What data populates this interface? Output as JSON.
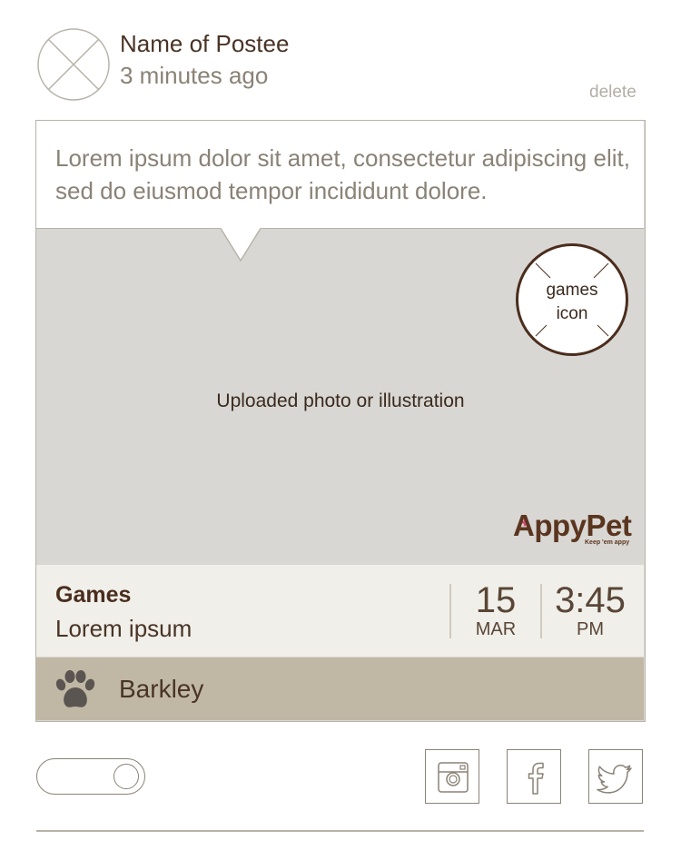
{
  "post": {
    "poster_name": "Name of Postee",
    "time_ago": "3 minutes ago",
    "delete_label": "delete",
    "caption": "Lorem ipsum dolor sit amet, consectetur adipiscing elit, sed do eiusmod tempor incididunt dolore."
  },
  "media": {
    "placeholder_label": "Uploaded photo or illustration",
    "category_icon_label_line1": "games",
    "category_icon_label_line2": "icon",
    "logo_text": "AppyPet",
    "logo_tagline": "Keep 'em appy"
  },
  "info": {
    "category_title": "Games",
    "category_subtitle": "Lorem ipsum",
    "date_day": "15",
    "date_month": "MAR",
    "time": "3:45",
    "time_ampm": "PM"
  },
  "pet": {
    "name": "Barkley",
    "icon": "paw-icon"
  },
  "share": {
    "toggle_state": "off",
    "buttons": [
      "instagram-icon",
      "facebook-icon",
      "twitter-icon"
    ]
  },
  "colors": {
    "brown_dark": "#4a2d1d",
    "muted_text": "#8a8276",
    "photo_bg": "#d9d7d3",
    "info_bg": "#f0efea",
    "pet_bg": "#c0b8a5"
  }
}
